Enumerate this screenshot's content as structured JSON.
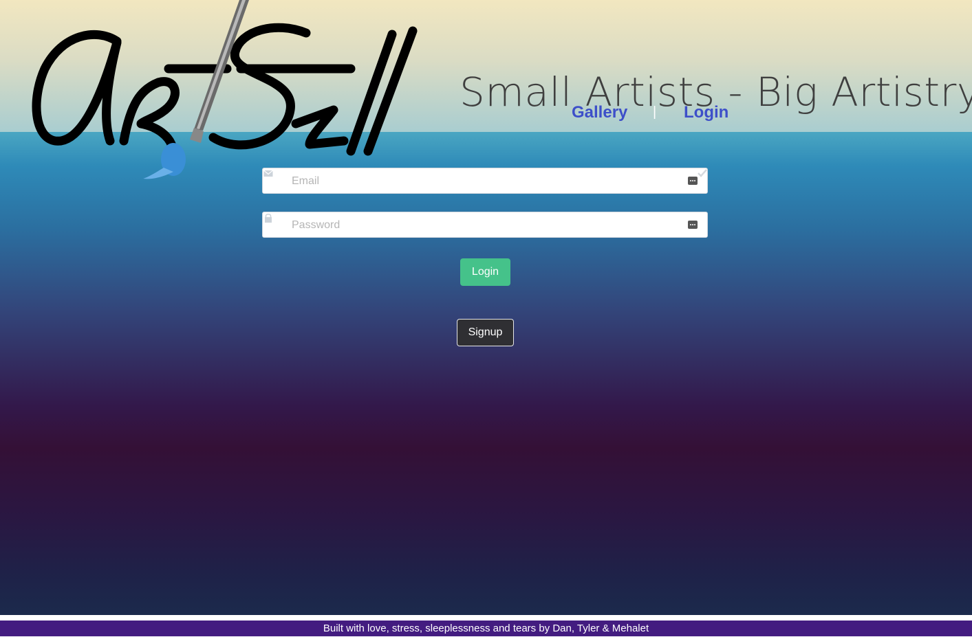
{
  "brand": {
    "logo_text": "ArtSell"
  },
  "header": {
    "tagline": "Small Artists - Big Artistry"
  },
  "nav": {
    "gallery": "Gallery",
    "separator": "|",
    "login": "Login"
  },
  "form": {
    "email": {
      "placeholder": "Email",
      "value": "",
      "icon": "envelope-icon"
    },
    "password": {
      "placeholder": "Password",
      "value": "",
      "icon": "lock-icon"
    },
    "login_button": "Login",
    "signup_button": "Signup"
  },
  "footer": {
    "text": "Built with love, stress, sleeplessness and tears by Dan, Tyler & Mehalet"
  },
  "colors": {
    "nav_link": "#3d4fc9",
    "login_button": "#45c28a",
    "signup_button": "#2f2f33",
    "footer_bg": "#431c80",
    "tagline": "#3f3f3f"
  }
}
